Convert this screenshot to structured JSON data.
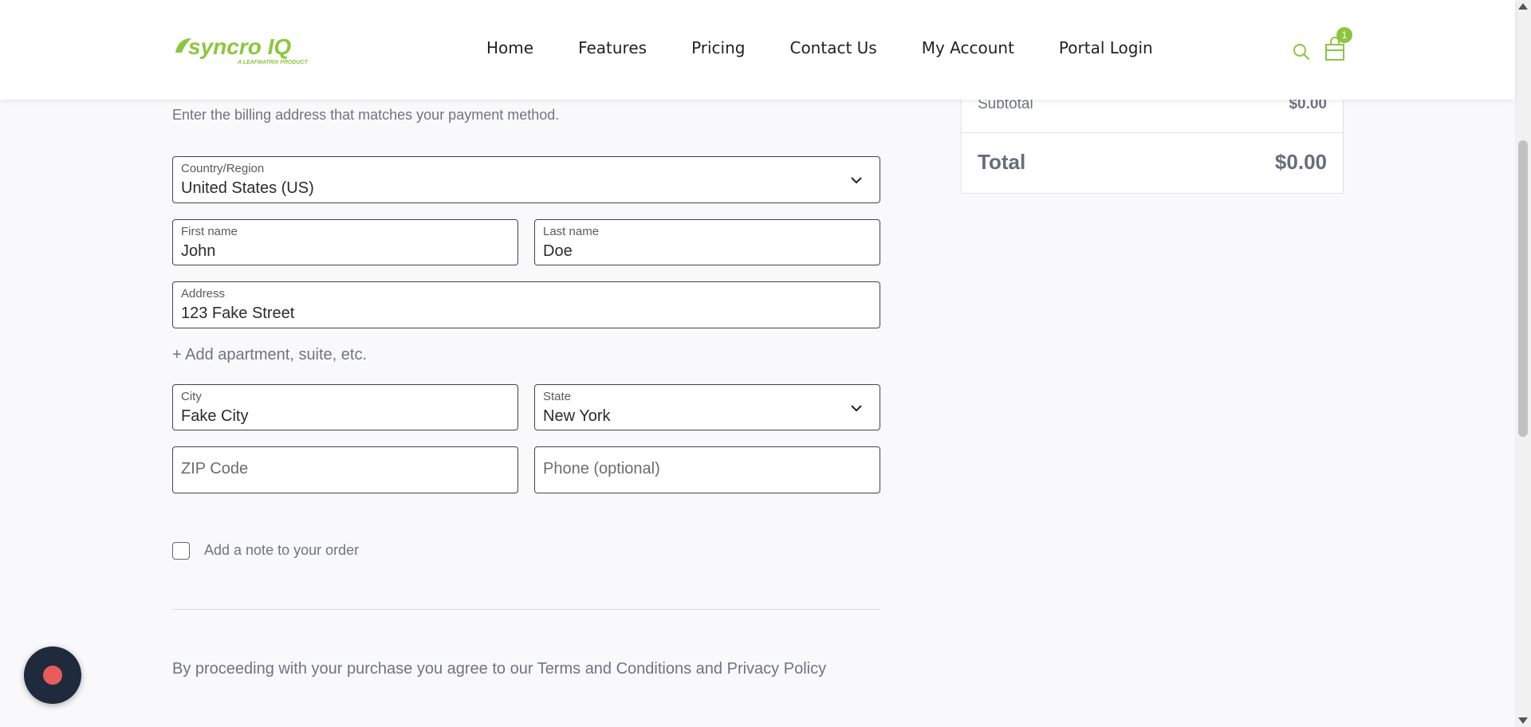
{
  "brand": {
    "name": "syncro IQ",
    "tagline": "A LEAFMATRIX PRODUCT",
    "accent": "#8cc63f"
  },
  "nav": [
    "Home",
    "Features",
    "Pricing",
    "Contact Us",
    "My Account",
    "Portal Login"
  ],
  "cart": {
    "count": "1"
  },
  "billing": {
    "subtitle": "Enter the billing address that matches your payment method.",
    "country": {
      "label": "Country/Region",
      "value": "United States (US)"
    },
    "first_name": {
      "label": "First name",
      "value": "John"
    },
    "last_name": {
      "label": "Last name",
      "value": "Doe"
    },
    "address": {
      "label": "Address",
      "value": "123 Fake Street"
    },
    "add_apt": "+ Add apartment, suite, etc.",
    "city": {
      "label": "City",
      "value": "Fake City"
    },
    "state": {
      "label": "State",
      "value": "New York"
    },
    "zip": {
      "placeholder": "ZIP Code"
    },
    "phone": {
      "placeholder": "Phone (optional)"
    },
    "note_label": "Add a note to your order",
    "terms": {
      "prefix": "By proceeding with your purchase you agree to our ",
      "terms_link": "Terms and Conditions",
      "and": " and ",
      "privacy_link": "Privacy Policy"
    }
  },
  "summary": {
    "subtotal_label": "Subtotal",
    "subtotal_value": "$0.00",
    "total_label": "Total",
    "total_value": "$0.00"
  }
}
